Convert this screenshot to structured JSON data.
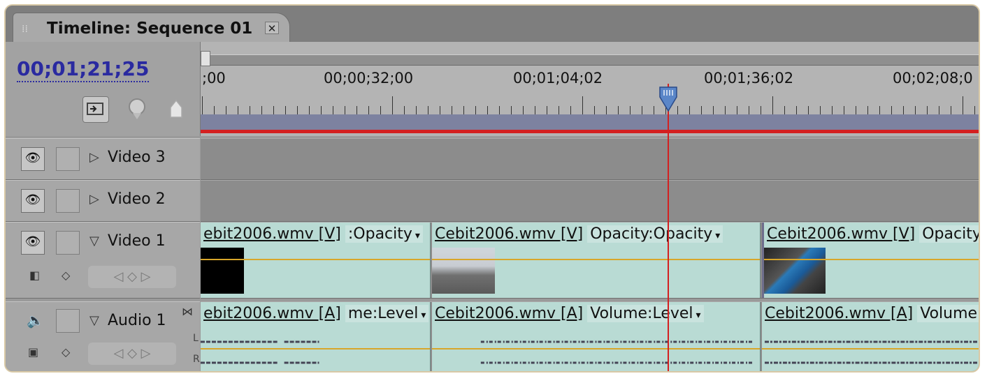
{
  "tab": {
    "title": "Timeline: Sequence 01",
    "close_glyph": "✕"
  },
  "timecode": "00;01;21;25",
  "ruler": {
    "labels": [
      ";00",
      "00;00;32;00",
      "00;01;04;02",
      "00;01;36;02",
      "00;02;08;0"
    ]
  },
  "tools": [
    "snap-icon",
    "set-marker-icon",
    "set-encore-marker-icon"
  ],
  "tracks": {
    "video3": {
      "name": "Video 3",
      "twirl": "▷"
    },
    "video2": {
      "name": "Video 2",
      "twirl": "▷"
    },
    "video1": {
      "name": "Video 1",
      "twirl": "▽",
      "clips": [
        {
          "name": "ebit2006.wmv [V]",
          "fx": ":Opacity"
        },
        {
          "name": "Cebit2006.wmv [V]",
          "fx": "Opacity:Opacity"
        },
        {
          "name": "Cebit2006.wmv [V]",
          "fx": "Opacity"
        }
      ]
    },
    "audio1": {
      "name": "Audio 1",
      "twirl": "▽",
      "clips": [
        {
          "name": "ebit2006.wmv [A]",
          "fx": "me:Level"
        },
        {
          "name": "Cebit2006.wmv [A]",
          "fx": "Volume:Level"
        },
        {
          "name": "Cebit2006.wmv [A]",
          "fx": "Volume"
        }
      ],
      "channel_l": "L",
      "channel_r": "R"
    }
  },
  "colors": {
    "clip": "#b9dbd4",
    "playhead": "#d42020",
    "timecode": "#2a2aa0",
    "work_area": "#7d82a0"
  }
}
